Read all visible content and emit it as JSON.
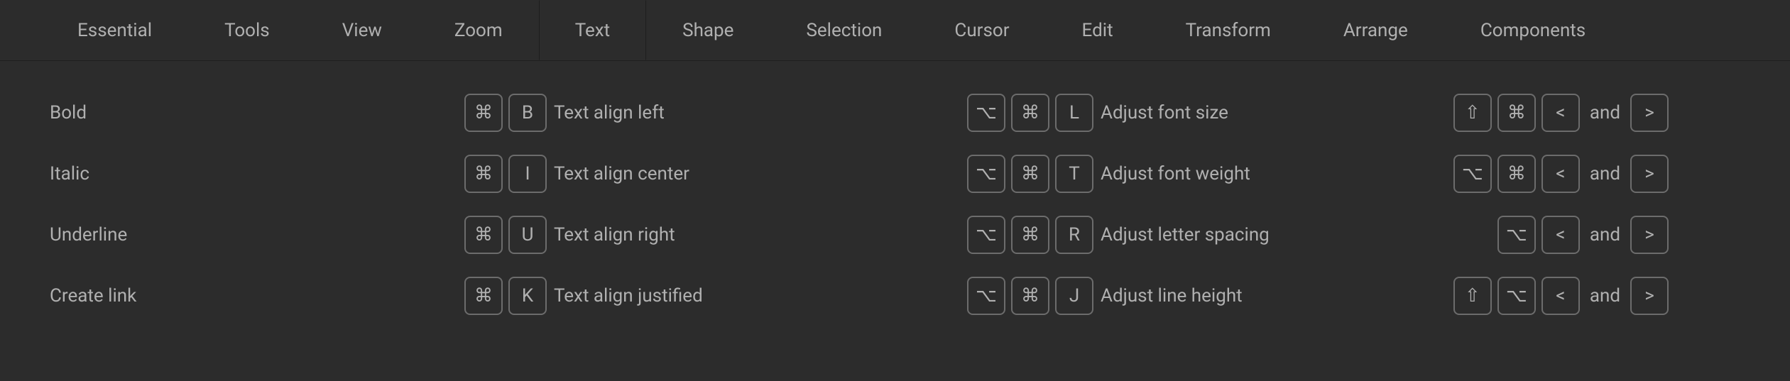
{
  "tabs": {
    "items": [
      {
        "label": "Essential",
        "active": false
      },
      {
        "label": "Tools",
        "active": false
      },
      {
        "label": "View",
        "active": false
      },
      {
        "label": "Zoom",
        "active": false
      },
      {
        "label": "Text",
        "active": true
      },
      {
        "label": "Shape",
        "active": false
      },
      {
        "label": "Selection",
        "active": false
      },
      {
        "label": "Cursor",
        "active": false
      },
      {
        "label": "Edit",
        "active": false
      },
      {
        "label": "Transform",
        "active": false
      },
      {
        "label": "Arrange",
        "active": false
      },
      {
        "label": "Components",
        "active": false
      }
    ]
  },
  "separator": "and",
  "col1": [
    {
      "label": "Bold",
      "keys": [
        "⌘",
        "B"
      ]
    },
    {
      "label": "Italic",
      "keys": [
        "⌘",
        "I"
      ]
    },
    {
      "label": "Underline",
      "keys": [
        "⌘",
        "U"
      ]
    },
    {
      "label": "Create link",
      "keys": [
        "⌘",
        "K"
      ]
    }
  ],
  "col2": [
    {
      "label": "Text align left",
      "keys": [
        "⌥",
        "⌘",
        "L"
      ]
    },
    {
      "label": "Text align center",
      "keys": [
        "⌥",
        "⌘",
        "T"
      ]
    },
    {
      "label": "Text align right",
      "keys": [
        "⌥",
        "⌘",
        "R"
      ]
    },
    {
      "label": "Text align justified",
      "keys": [
        "⌥",
        "⌘",
        "J"
      ]
    }
  ],
  "col3": [
    {
      "label": "Adjust font size",
      "keys1": [
        "⇧",
        "⌘",
        "<"
      ],
      "keys2": [
        ">"
      ]
    },
    {
      "label": "Adjust font weight",
      "keys1": [
        "⌥",
        "⌘",
        "<"
      ],
      "keys2": [
        ">"
      ]
    },
    {
      "label": "Adjust letter spacing",
      "keys1": [
        "⌥",
        "<"
      ],
      "keys2": [
        ">"
      ]
    },
    {
      "label": "Adjust line height",
      "keys1": [
        "⇧",
        "⌥",
        "<"
      ],
      "keys2": [
        ">"
      ]
    }
  ]
}
